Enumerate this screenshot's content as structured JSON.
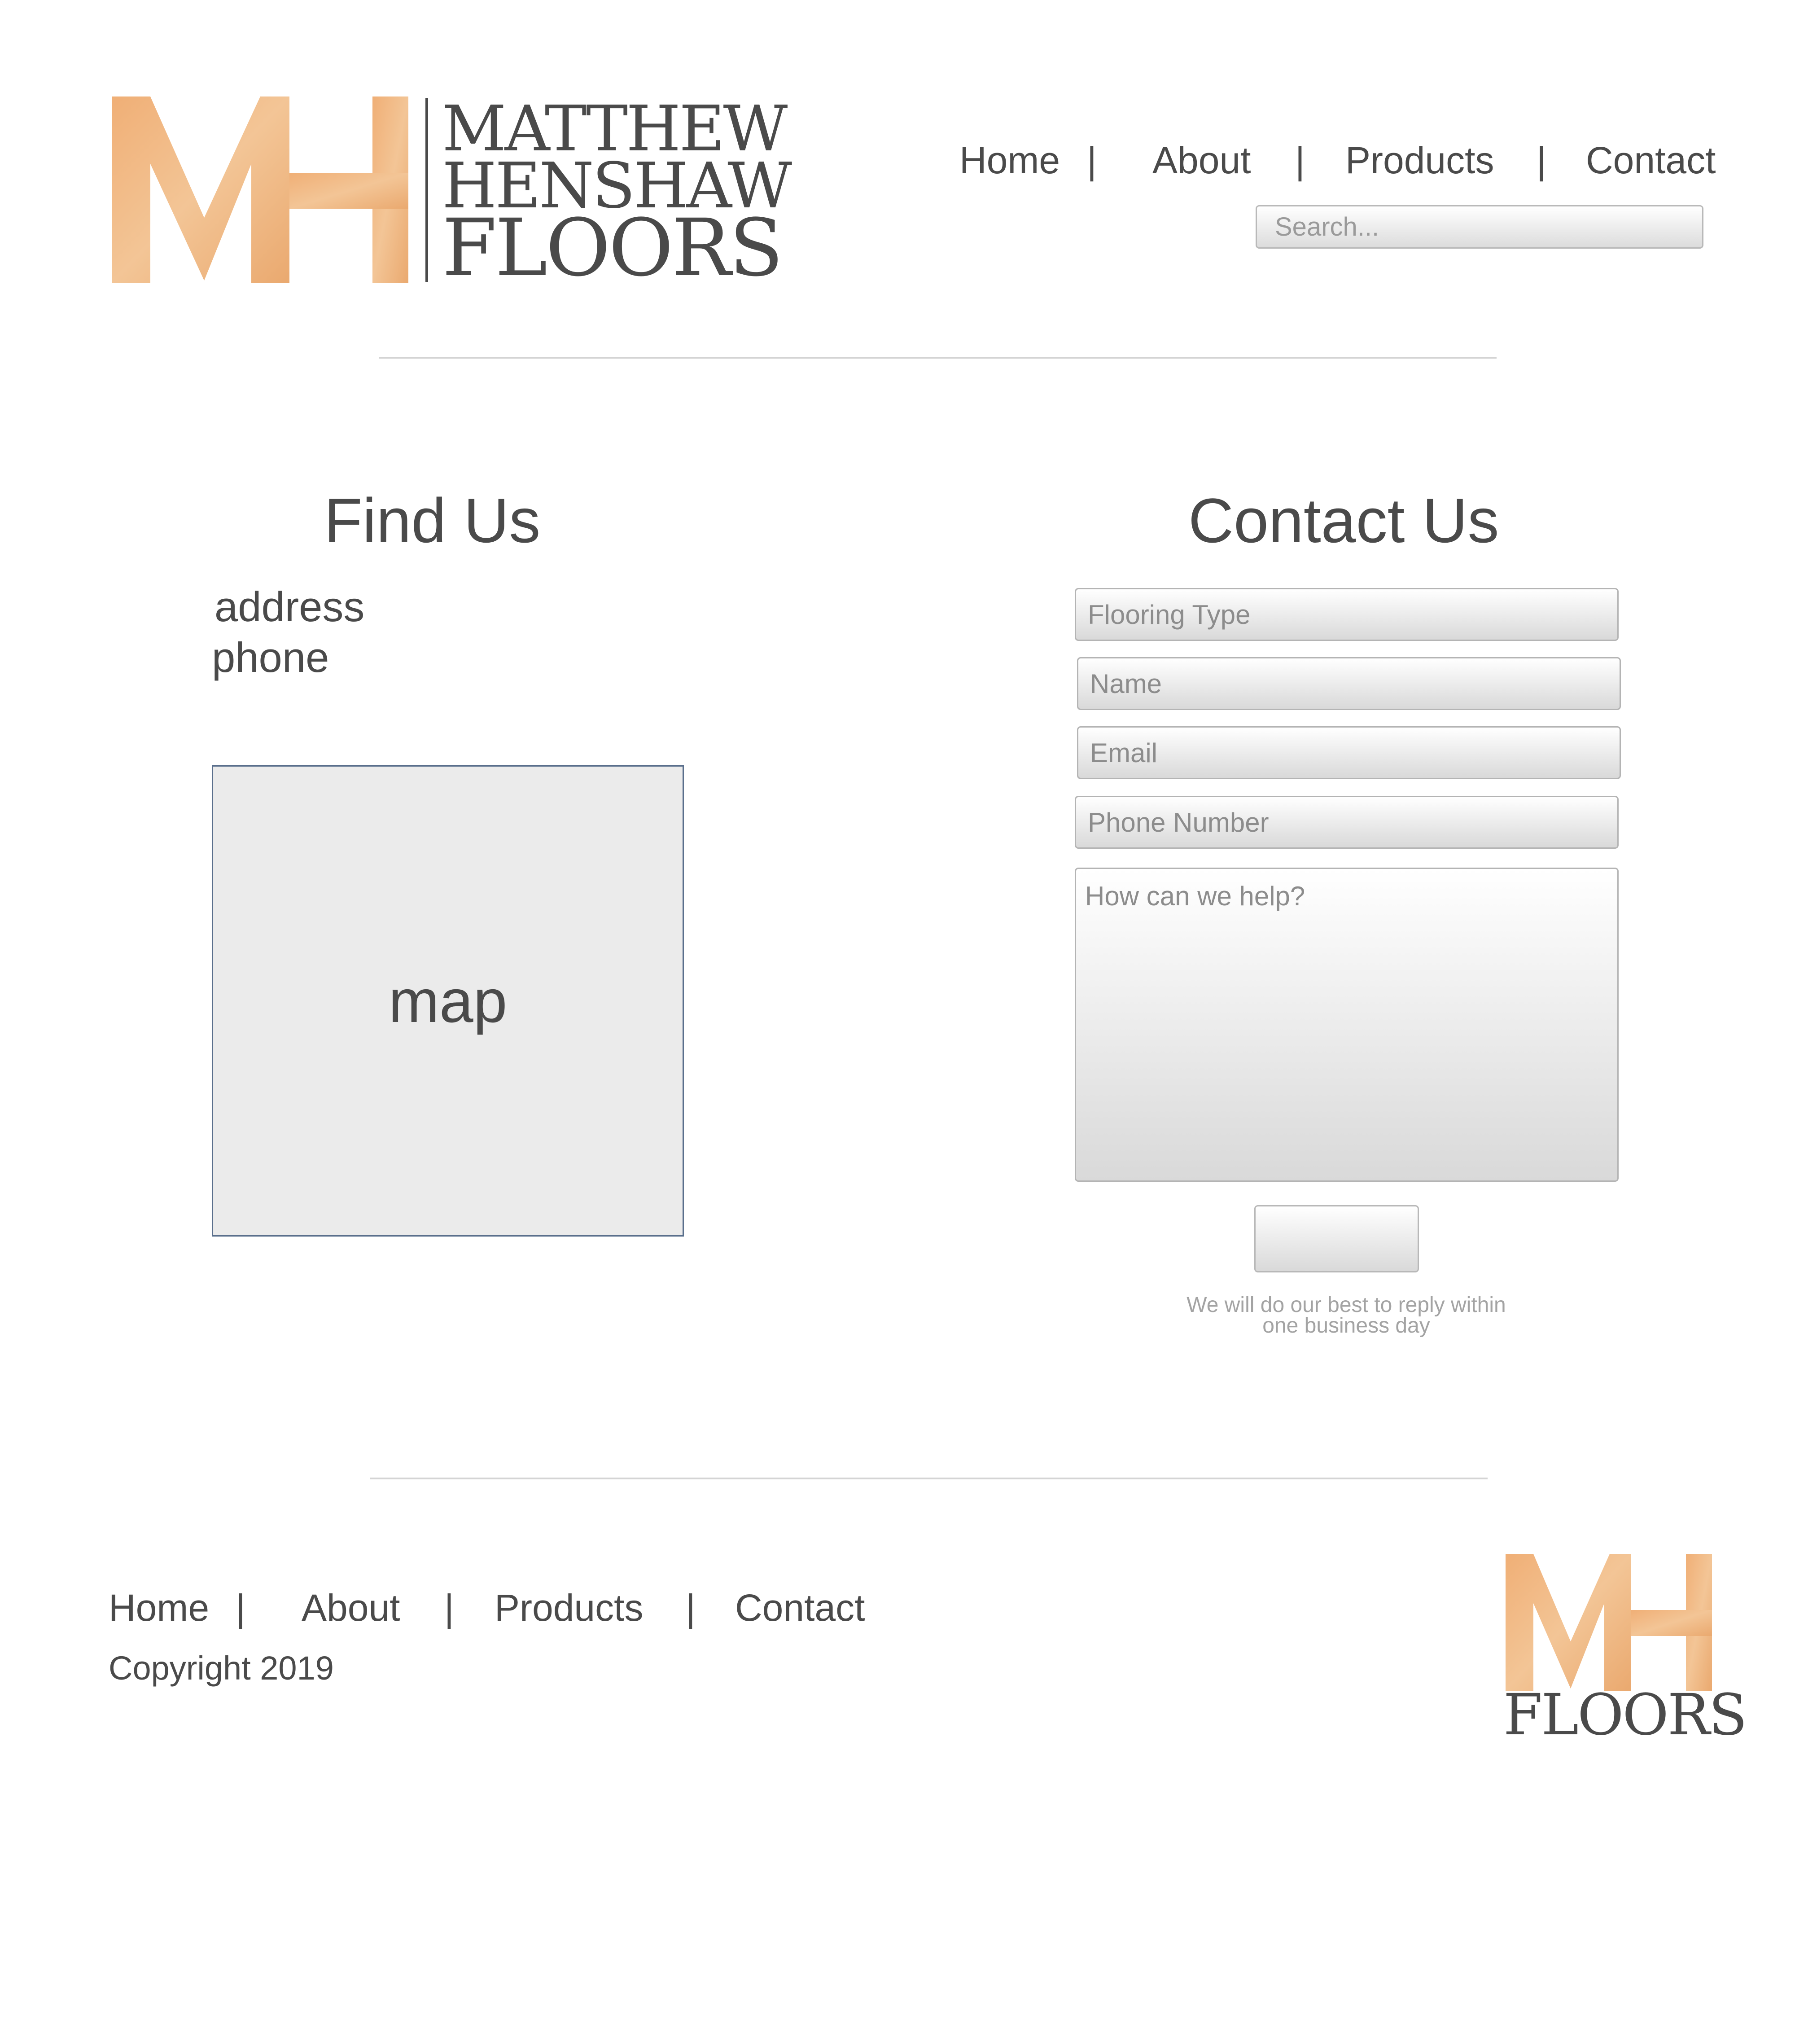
{
  "brand": {
    "monogram": "MH",
    "line1": "MATTHEW",
    "line2": "HENSHAW",
    "line3": "FLOORS",
    "footer_word": "FLOORS",
    "wood_color": "#efb985"
  },
  "nav": {
    "items": [
      "Home",
      "About",
      "Products",
      "Contact"
    ],
    "separator": "|"
  },
  "search": {
    "placeholder": "Search..."
  },
  "find_us": {
    "title": "Find Us",
    "address": "address",
    "phone": "phone",
    "map_label": "map"
  },
  "contact": {
    "title": "Contact Us",
    "fields": {
      "flooring_type": "Flooring Type",
      "name": "Name",
      "email": "Email",
      "phone": "Phone Number",
      "message": "How can we help?"
    },
    "note_line1": "We will do our best to reply within",
    "note_line2": "one business day"
  },
  "footer": {
    "nav": [
      "Home",
      "About",
      "Products",
      "Contact"
    ],
    "separator": "|",
    "copyright": "Copyright 2019"
  }
}
